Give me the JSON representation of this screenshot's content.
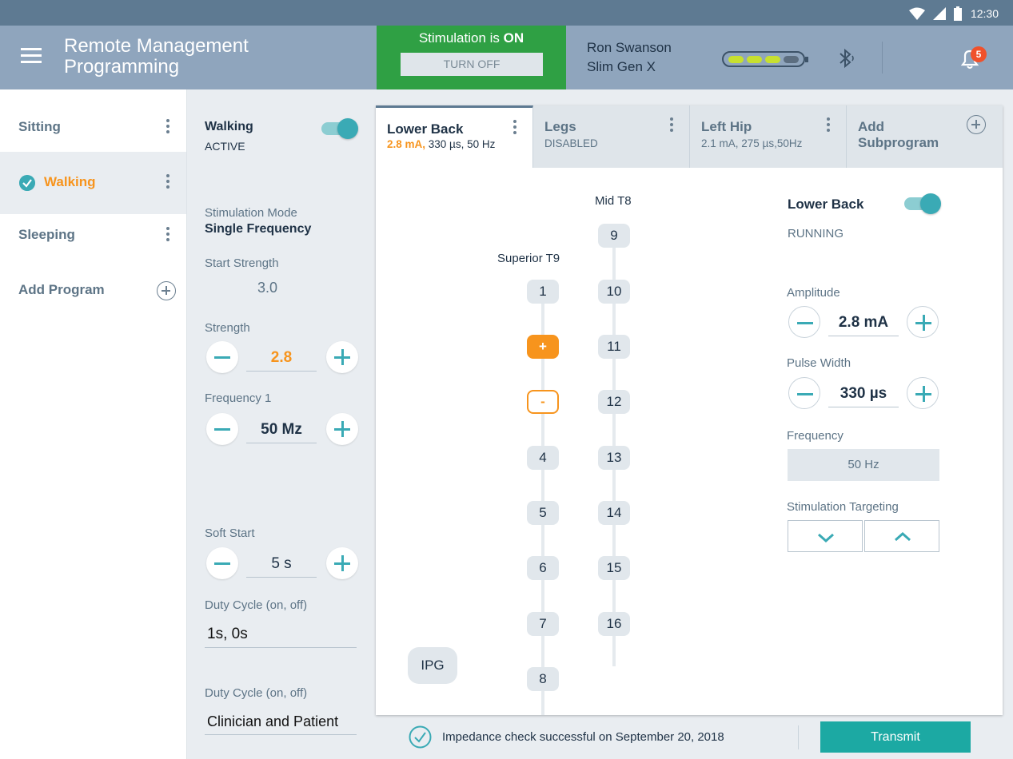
{
  "status_bar": {
    "time": "12:30",
    "icons": [
      "wifi-icon",
      "signal-icon",
      "battery-icon"
    ]
  },
  "app_bar": {
    "title": "Remote Management Programming",
    "stimulation_prefix": "Stimulation is ",
    "stimulation_state": "ON",
    "turn_off_label": "TURN OFF",
    "patient_name": "Ron Swanson",
    "device_name": "Slim Gen X",
    "battery_level": 0.75,
    "notification_count": "5",
    "stim_color": "#2fa044"
  },
  "programs": {
    "items": [
      {
        "label": "Sitting",
        "selected": false
      },
      {
        "label": "Walking",
        "selected": true
      },
      {
        "label": "Sleeping",
        "selected": false
      }
    ],
    "add_label": "Add Program"
  },
  "settings": {
    "program_name": "Walking",
    "program_status": "ACTIVE",
    "program_enabled": true,
    "stim_mode_label": "Stimulation Mode",
    "stim_mode_value": "Single Frequency",
    "start_strength_label": "Start Strength",
    "start_strength_value": "3.0",
    "strength_label": "Strength",
    "strength_value": "2.8",
    "frequency_label": "Frequency 1",
    "frequency_value": "50 Mz",
    "soft_start_label": "Soft Start",
    "soft_start_value": "5 s",
    "duty_cycle_label": "Duty Cycle (on, off)",
    "duty_cycle_value": "1s, 0s",
    "duty_cycle2_label": "Duty Cycle (on, off)",
    "duty_cycle2_value": "Clinician and  Patient"
  },
  "tabs": [
    {
      "name": "Lower Back",
      "detail_highlight": "2.8 mA,",
      "detail": " 330 µs, 50 Hz",
      "active": true
    },
    {
      "name": "Legs",
      "detail_highlight": "",
      "detail": "DISABLED",
      "active": false
    },
    {
      "name": "Left Hip",
      "detail_highlight": "",
      "detail": "2.1 mA, 275 µs,50Hz",
      "active": false
    },
    {
      "name": "Add Subprogram",
      "detail_highlight": "",
      "detail": "",
      "active": false
    }
  ],
  "lead": {
    "left_label": "Superior T9",
    "right_label": "Mid T8",
    "ipg_label": "IPG",
    "left_contacts": [
      "1",
      "+",
      "-",
      "4",
      "5",
      "6",
      "7",
      "8"
    ],
    "right_contacts": [
      "9",
      "10",
      "11",
      "12",
      "13",
      "14",
      "15",
      "16"
    ],
    "anode_contact": "+",
    "cathode_contact": "-"
  },
  "subprogram": {
    "name": "Lower Back",
    "status": "RUNNING",
    "enabled": true,
    "amplitude_label": "Amplitude",
    "amplitude_value": "2.8 mA",
    "pulse_width_label": "Pulse Width",
    "pulse_width_value": "330 µs",
    "frequency_label": "Frequency",
    "frequency_value": "50 Hz",
    "targeting_label": "Stimulation Targeting"
  },
  "footer": {
    "impedance_text": "Impedance check successful on September 20, 2018",
    "transmit_label": "Transmit"
  }
}
